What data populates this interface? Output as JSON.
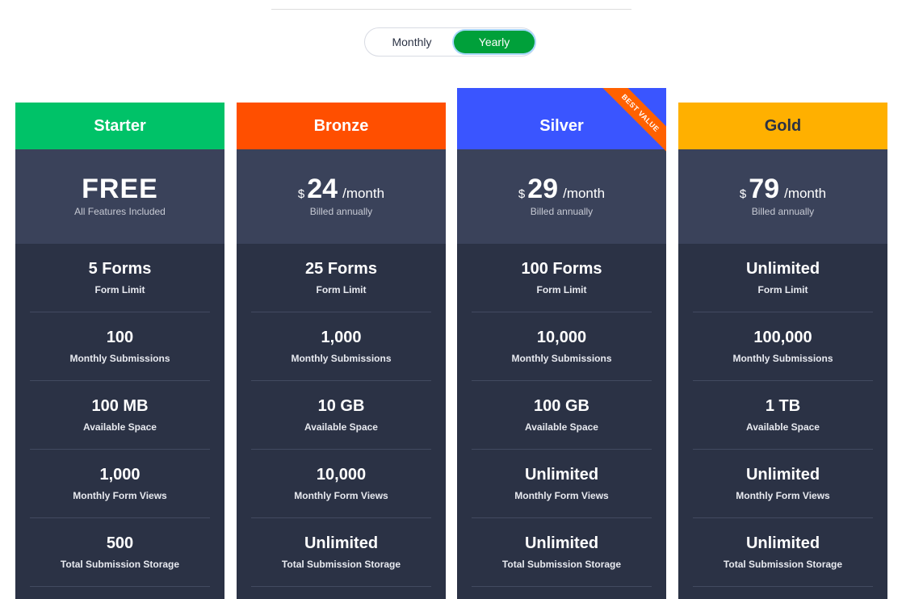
{
  "toggle": {
    "monthly": "Monthly",
    "yearly": "Yearly",
    "selected": "Yearly"
  },
  "plans": [
    {
      "name": "Starter",
      "color": "#00c268",
      "price": "FREE",
      "price_note": "All Features Included",
      "features": [
        {
          "value": "5 Forms",
          "label": "Form Limit"
        },
        {
          "value": "100",
          "label": "Monthly Submissions"
        },
        {
          "value": "100 MB",
          "label": "Available Space"
        },
        {
          "value": "1,000",
          "label": "Monthly Form Views"
        },
        {
          "value": "500",
          "label": "Total Submission Storage"
        }
      ]
    },
    {
      "name": "Bronze",
      "color": "#ff4f00",
      "currency": "$",
      "amount": "24",
      "period": "/month",
      "price_note": "Billed annually",
      "features": [
        {
          "value": "25 Forms",
          "label": "Form Limit"
        },
        {
          "value": "1,000",
          "label": "Monthly Submissions"
        },
        {
          "value": "10 GB",
          "label": "Available Space"
        },
        {
          "value": "10,000",
          "label": "Monthly Form Views"
        },
        {
          "value": "Unlimited",
          "label": "Total Submission Storage"
        }
      ]
    },
    {
      "name": "Silver",
      "color": "#3a55ff",
      "currency": "$",
      "amount": "29",
      "period": "/month",
      "price_note": "Billed annually",
      "badge": "BEST VALUE",
      "features": [
        {
          "value": "100 Forms",
          "label": "Form Limit"
        },
        {
          "value": "10,000",
          "label": "Monthly Submissions"
        },
        {
          "value": "100 GB",
          "label": "Available Space"
        },
        {
          "value": "Unlimited",
          "label": "Monthly Form Views"
        },
        {
          "value": "Unlimited",
          "label": "Total Submission Storage"
        }
      ]
    },
    {
      "name": "Gold",
      "color": "#ffb000",
      "currency": "$",
      "amount": "79",
      "period": "/month",
      "price_note": "Billed annually",
      "features": [
        {
          "value": "Unlimited",
          "label": "Form Limit"
        },
        {
          "value": "100,000",
          "label": "Monthly Submissions"
        },
        {
          "value": "1 TB",
          "label": "Available Space"
        },
        {
          "value": "Unlimited",
          "label": "Monthly Form Views"
        },
        {
          "value": "Unlimited",
          "label": "Total Submission Storage"
        }
      ]
    }
  ]
}
